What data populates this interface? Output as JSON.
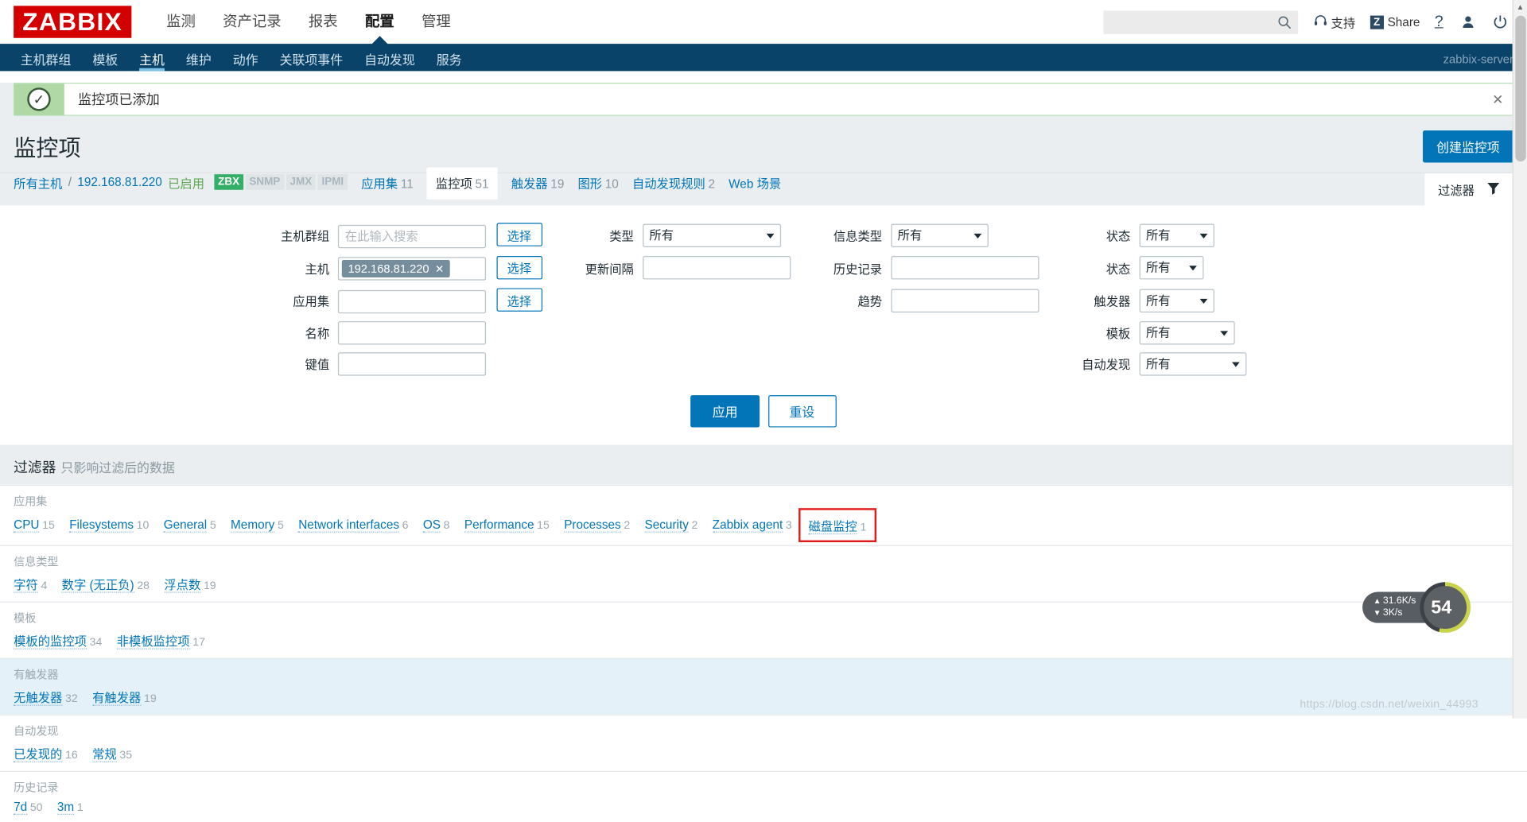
{
  "header": {
    "logo": "ZABBIX",
    "nav": [
      {
        "label": "监测",
        "selected": false
      },
      {
        "label": "资产记录",
        "selected": false
      },
      {
        "label": "报表",
        "selected": false
      },
      {
        "label": "配置",
        "selected": true
      },
      {
        "label": "管理",
        "selected": false
      }
    ],
    "search_placeholder": "",
    "search_value": "",
    "support_label": "支持",
    "share_label": "Share",
    "share_badge": "Z",
    "help_label": "?",
    "icons": [
      "headset-icon",
      "share-icon",
      "help-icon",
      "user-icon",
      "power-icon"
    ]
  },
  "subnav": {
    "items": [
      {
        "label": "主机群组",
        "selected": false
      },
      {
        "label": "模板",
        "selected": false
      },
      {
        "label": "主机",
        "selected": true
      },
      {
        "label": "维护",
        "selected": false
      },
      {
        "label": "动作",
        "selected": false
      },
      {
        "label": "关联项事件",
        "selected": false
      },
      {
        "label": "自动发现",
        "selected": false
      },
      {
        "label": "服务",
        "selected": false
      }
    ],
    "server": "zabbix-server"
  },
  "message": {
    "text": "监控项已添加",
    "icon": "check-icon",
    "close": "✕"
  },
  "page": {
    "title": "监控项",
    "create_button": "创建监控项"
  },
  "breadcrumb": {
    "all_hosts": "所有主机",
    "separator": "/",
    "host": "192.168.81.220",
    "status": "已启用",
    "protocols": [
      {
        "label": "ZBX",
        "active": true
      },
      {
        "label": "SNMP",
        "active": false
      },
      {
        "label": "JMX",
        "active": false
      },
      {
        "label": "IPMI",
        "active": false
      }
    ],
    "tabs": [
      {
        "label": "应用集",
        "count": "11",
        "selected": false
      },
      {
        "label": "监控项",
        "count": "51",
        "selected": true
      },
      {
        "label": "触发器",
        "count": "19",
        "selected": false
      },
      {
        "label": "图形",
        "count": "10",
        "selected": false
      },
      {
        "label": "自动发现规则",
        "count": "2",
        "selected": false
      },
      {
        "label": "Web 场景",
        "count": "",
        "selected": false
      }
    ],
    "filter_tab": "过滤器",
    "filter_icon": "funnel-icon"
  },
  "filter": {
    "col1": [
      {
        "label": "主机群组",
        "type": "text",
        "value": "",
        "placeholder": "在此输入搜索",
        "button": "选择"
      },
      {
        "label": "主机",
        "type": "chip",
        "value": "192.168.81.220",
        "button": "选择"
      },
      {
        "label": "应用集",
        "type": "text",
        "value": "",
        "placeholder": "",
        "button": "选择"
      },
      {
        "label": "名称",
        "type": "text",
        "value": "",
        "placeholder": "",
        "button": ""
      },
      {
        "label": "键值",
        "type": "text",
        "value": "",
        "placeholder": "",
        "button": ""
      }
    ],
    "col2": [
      {
        "label": "类型",
        "type": "select",
        "value": "所有"
      },
      {
        "label": "更新间隔",
        "type": "text",
        "value": ""
      }
    ],
    "col3": [
      {
        "label": "信息类型",
        "type": "select",
        "value": "所有"
      },
      {
        "label": "历史记录",
        "type": "text",
        "value": ""
      },
      {
        "label": "趋势",
        "type": "text",
        "value": ""
      }
    ],
    "col4": [
      {
        "label": "状态",
        "type": "select",
        "value": "所有"
      },
      {
        "label": "状态",
        "type": "select",
        "value": "所有"
      },
      {
        "label": "触发器",
        "type": "select",
        "value": "所有"
      },
      {
        "label": "模板",
        "type": "select",
        "value": "所有"
      },
      {
        "label": "自动发现",
        "type": "select",
        "value": "所有"
      }
    ],
    "apply": "应用",
    "reset": "重设"
  },
  "subfilter": {
    "title": "过滤器",
    "subtitle": "只影响过滤后的数据",
    "sections": [
      {
        "heading": "应用集",
        "items": [
          {
            "label": "CPU",
            "count": "15",
            "highlight": false
          },
          {
            "label": "Filesystems",
            "count": "10",
            "highlight": false
          },
          {
            "label": "General",
            "count": "5",
            "highlight": false
          },
          {
            "label": "Memory",
            "count": "5",
            "highlight": false
          },
          {
            "label": "Network interfaces",
            "count": "6",
            "highlight": false
          },
          {
            "label": "OS",
            "count": "8",
            "highlight": false
          },
          {
            "label": "Performance",
            "count": "15",
            "highlight": false
          },
          {
            "label": "Processes",
            "count": "2",
            "highlight": false
          },
          {
            "label": "Security",
            "count": "2",
            "highlight": false
          },
          {
            "label": "Zabbix agent",
            "count": "3",
            "highlight": false
          },
          {
            "label": "磁盘监控",
            "count": "1",
            "highlight": true
          }
        ]
      },
      {
        "heading": "信息类型",
        "items": [
          {
            "label": "字符",
            "count": "4",
            "highlight": false
          },
          {
            "label": "数字 (无正负)",
            "count": "28",
            "highlight": false
          },
          {
            "label": "浮点数",
            "count": "19",
            "highlight": false
          }
        ]
      },
      {
        "heading": "模板",
        "items": [
          {
            "label": "模板的监控项",
            "count": "34",
            "highlight": false
          },
          {
            "label": "非模板监控项",
            "count": "17",
            "highlight": false
          }
        ]
      },
      {
        "heading": "有触发器",
        "items": [
          {
            "label": "无触发器",
            "count": "32",
            "highlight": false
          },
          {
            "label": "有触发器",
            "count": "19",
            "highlight": false
          }
        ]
      },
      {
        "heading": "自动发现",
        "items": [
          {
            "label": "已发现的",
            "count": "16",
            "highlight": false
          },
          {
            "label": "常规",
            "count": "35",
            "highlight": false
          }
        ]
      },
      {
        "heading": "历史记录",
        "items": [
          {
            "label": "7d",
            "count": "50",
            "highlight": false
          },
          {
            "label": "3m",
            "count": "1",
            "highlight": false
          }
        ]
      }
    ]
  },
  "widget": {
    "upload": "31.6K/s",
    "download": "3K/s",
    "up_arrow": "▲",
    "down_arrow": "▼",
    "gauge_value": "54",
    "gauge_unit": "%"
  },
  "watermark": "https://blog.csdn.net/weixin_44993",
  "colors": {
    "brand_red": "#D40000",
    "subnav_blue": "#0A4369",
    "accent_blue": "#0275B8",
    "success_green": "#AFD8A4",
    "highlight_red": "#E41B1B",
    "zbx_green": "#34AF67"
  }
}
